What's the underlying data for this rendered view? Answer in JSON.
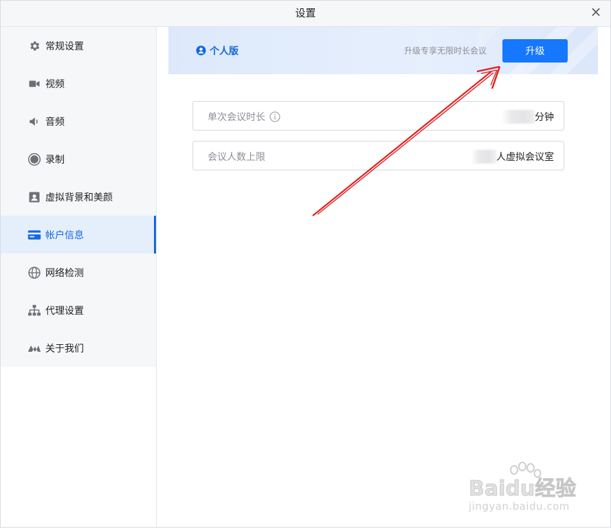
{
  "window": {
    "title": "设置",
    "close_symbol": "×"
  },
  "sidebar": {
    "items": [
      {
        "label": "常规设置",
        "icon": "gear-icon",
        "active": false
      },
      {
        "label": "视频",
        "icon": "video-camera-icon",
        "active": false
      },
      {
        "label": "音频",
        "icon": "speaker-icon",
        "active": false
      },
      {
        "label": "录制",
        "icon": "record-icon",
        "active": false
      },
      {
        "label": "虚拟背景和美颜",
        "icon": "portrait-icon",
        "active": false
      },
      {
        "label": "帐户信息",
        "icon": "card-icon",
        "active": true
      },
      {
        "label": "网络检测",
        "icon": "globe-icon",
        "active": false
      },
      {
        "label": "代理设置",
        "icon": "network-tree-icon",
        "active": false
      },
      {
        "label": "关于我们",
        "icon": "app-logo-icon",
        "active": false
      }
    ]
  },
  "account": {
    "edition_label": "个人版",
    "upgrade_tip": "升级专享无限时长会议",
    "upgrade_button": "升级",
    "rows": [
      {
        "label": "单次会议时长",
        "value_suffix": "分钟"
      },
      {
        "label": "会议人数上限",
        "value_suffix": "人虚拟会议室"
      }
    ]
  },
  "watermark": {
    "url": "jingyan.baidu.com"
  },
  "colors": {
    "accent": "#1677ff",
    "active_text": "#1468e0",
    "active_bg": "#e5effc",
    "annotation_arrow": "#e02020"
  }
}
